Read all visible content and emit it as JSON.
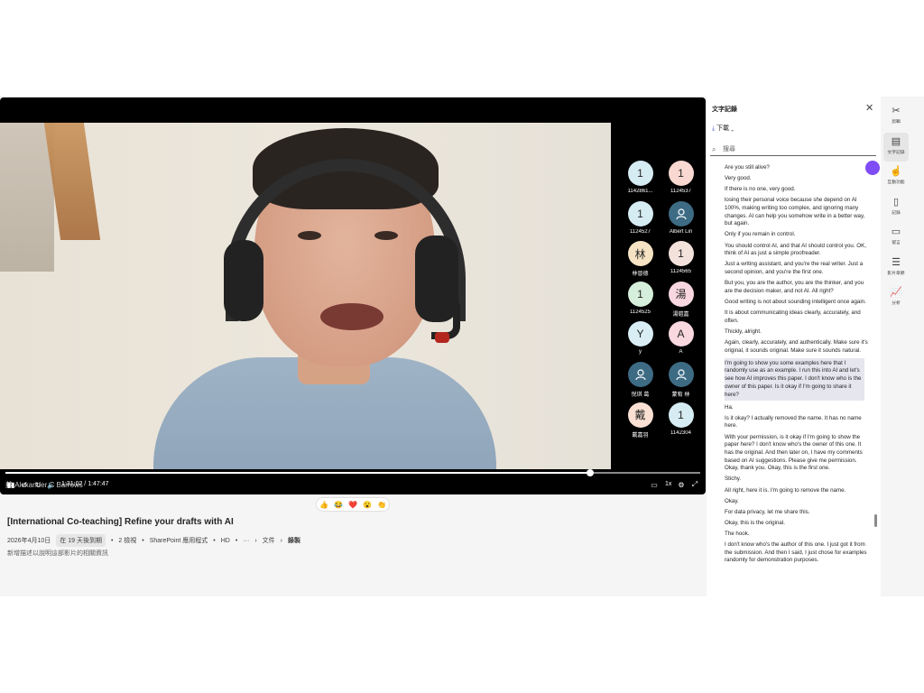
{
  "video": {
    "overlay_name": "蘇 Alexander C Barrows",
    "time": "1:31:02 / 1:47:47",
    "progress": 0.842,
    "speed": "1x",
    "participants": [
      {
        "initial": "1",
        "label": "1142861...",
        "color": "#d6ecf3"
      },
      {
        "initial": "1",
        "label": "1124537",
        "color": "#f9d8d1"
      },
      {
        "initial": "1",
        "label": "1124527",
        "color": "#d6ecf3"
      },
      {
        "initial": "",
        "label": "Albert Lin",
        "color": "#3d6b84"
      },
      {
        "initial": "林",
        "label": "林晉德",
        "color": "#f6e3c3"
      },
      {
        "initial": "1",
        "label": "1124565",
        "color": "#f3e1dc"
      },
      {
        "initial": "1",
        "label": "1124525",
        "color": "#d6efdc"
      },
      {
        "initial": "湯",
        "label": "湯鎧嘉",
        "color": "#f9d7e0"
      },
      {
        "initial": "Y",
        "label": "y",
        "color": "#d9eef4"
      },
      {
        "initial": "A",
        "label": "A",
        "color": "#f9d8e0"
      },
      {
        "initial": "",
        "label": "悅琪 葛",
        "color": "#3d6b84"
      },
      {
        "initial": "",
        "label": "蒙宥 林",
        "color": "#3d6b84"
      },
      {
        "initial": "戴",
        "label": "戴嘉羽",
        "color": "#f9e0d2"
      },
      {
        "initial": "1",
        "label": "1142304",
        "color": "#d6ecf3"
      }
    ]
  },
  "reactions": [
    "👍",
    "😂",
    "❤️",
    "😮",
    "👏"
  ],
  "meta": {
    "title": "[International Co-teaching] Refine your drafts with AI",
    "date": "2026年4月10日",
    "expiry": "在 19 天後到期",
    "views": "2 檢視",
    "app": "SharePoint 應用程式",
    "quality": "HD",
    "more": "···",
    "crumb1": "文件",
    "crumb2": "錄製",
    "description": "新增描述以說明這部影片的相關資訊"
  },
  "panel": {
    "title": "文字記錄",
    "download": "下載",
    "search_placeholder": "搜尋",
    "segments": [
      "Are you still alive?",
      "Very good.",
      "If there is no one, very good.",
      "losing their personal voice because she depend on AI 100%, making writing too complex, and ignoring many changes. AI can help you somehow write in a better way, but again.",
      "Only if you remain in control.",
      "You should control AI, and that AI should control you. OK, think of AI as just a simple proofreader.",
      "Just a writing assistant, and you're the real writer. Just a second opinion, and you're the first one.",
      "But you, you are the author, you are the thinker, and you are the decision maker, and not AI. All right?",
      "Good writing is not about sounding intelligent once again.",
      "It is about communicating ideas clearly, accurately, and often.",
      "Thickly, alright.",
      "Again, clearly, accurately, and authentically. Make sure it's original, it sounds original. Make sure it sounds natural.",
      "I'm going to show you some examples here that I randomly use as an example. I run this into AI and let's see how AI improves this paper. I don't know who is the owner of this paper. Is it okay if I'm going to share it here?",
      "Ha.",
      "Is it okay? I actually removed the name. It has no name here.",
      "With your permission, is it okay if I'm going to show the paper here? I don't know who's the owner of this one. It has the original. And then later on, I have my comments based on AI suggestions. Please give me permission. Okay, thank you. Okay, this is the first one.",
      "Stichy.",
      "All right, here it is. I'm going to remove the name.",
      "Okay.",
      "For data privacy, let me share this.",
      "Okay, this is the original.",
      "The hook.",
      "I don't know who's the author of this one. I just got it from the submission. And then I said, I just chose for examples randomly for demonstration purposes."
    ]
  },
  "rail": [
    {
      "icon": "scissors-icon",
      "glyph": "✂",
      "label": "剪輯"
    },
    {
      "icon": "transcript-icon",
      "glyph": "▤",
      "label": "文字記錄"
    },
    {
      "icon": "interactive-icon",
      "glyph": "☝",
      "label": "互動功能"
    },
    {
      "icon": "notes-icon",
      "glyph": "▯",
      "label": "記錄"
    },
    {
      "icon": "comment-icon",
      "glyph": "▭",
      "label": "留言"
    },
    {
      "icon": "chapters-icon",
      "glyph": "☰",
      "label": "影片章節"
    },
    {
      "icon": "analytics-icon",
      "glyph": "📈",
      "label": "分析"
    }
  ]
}
